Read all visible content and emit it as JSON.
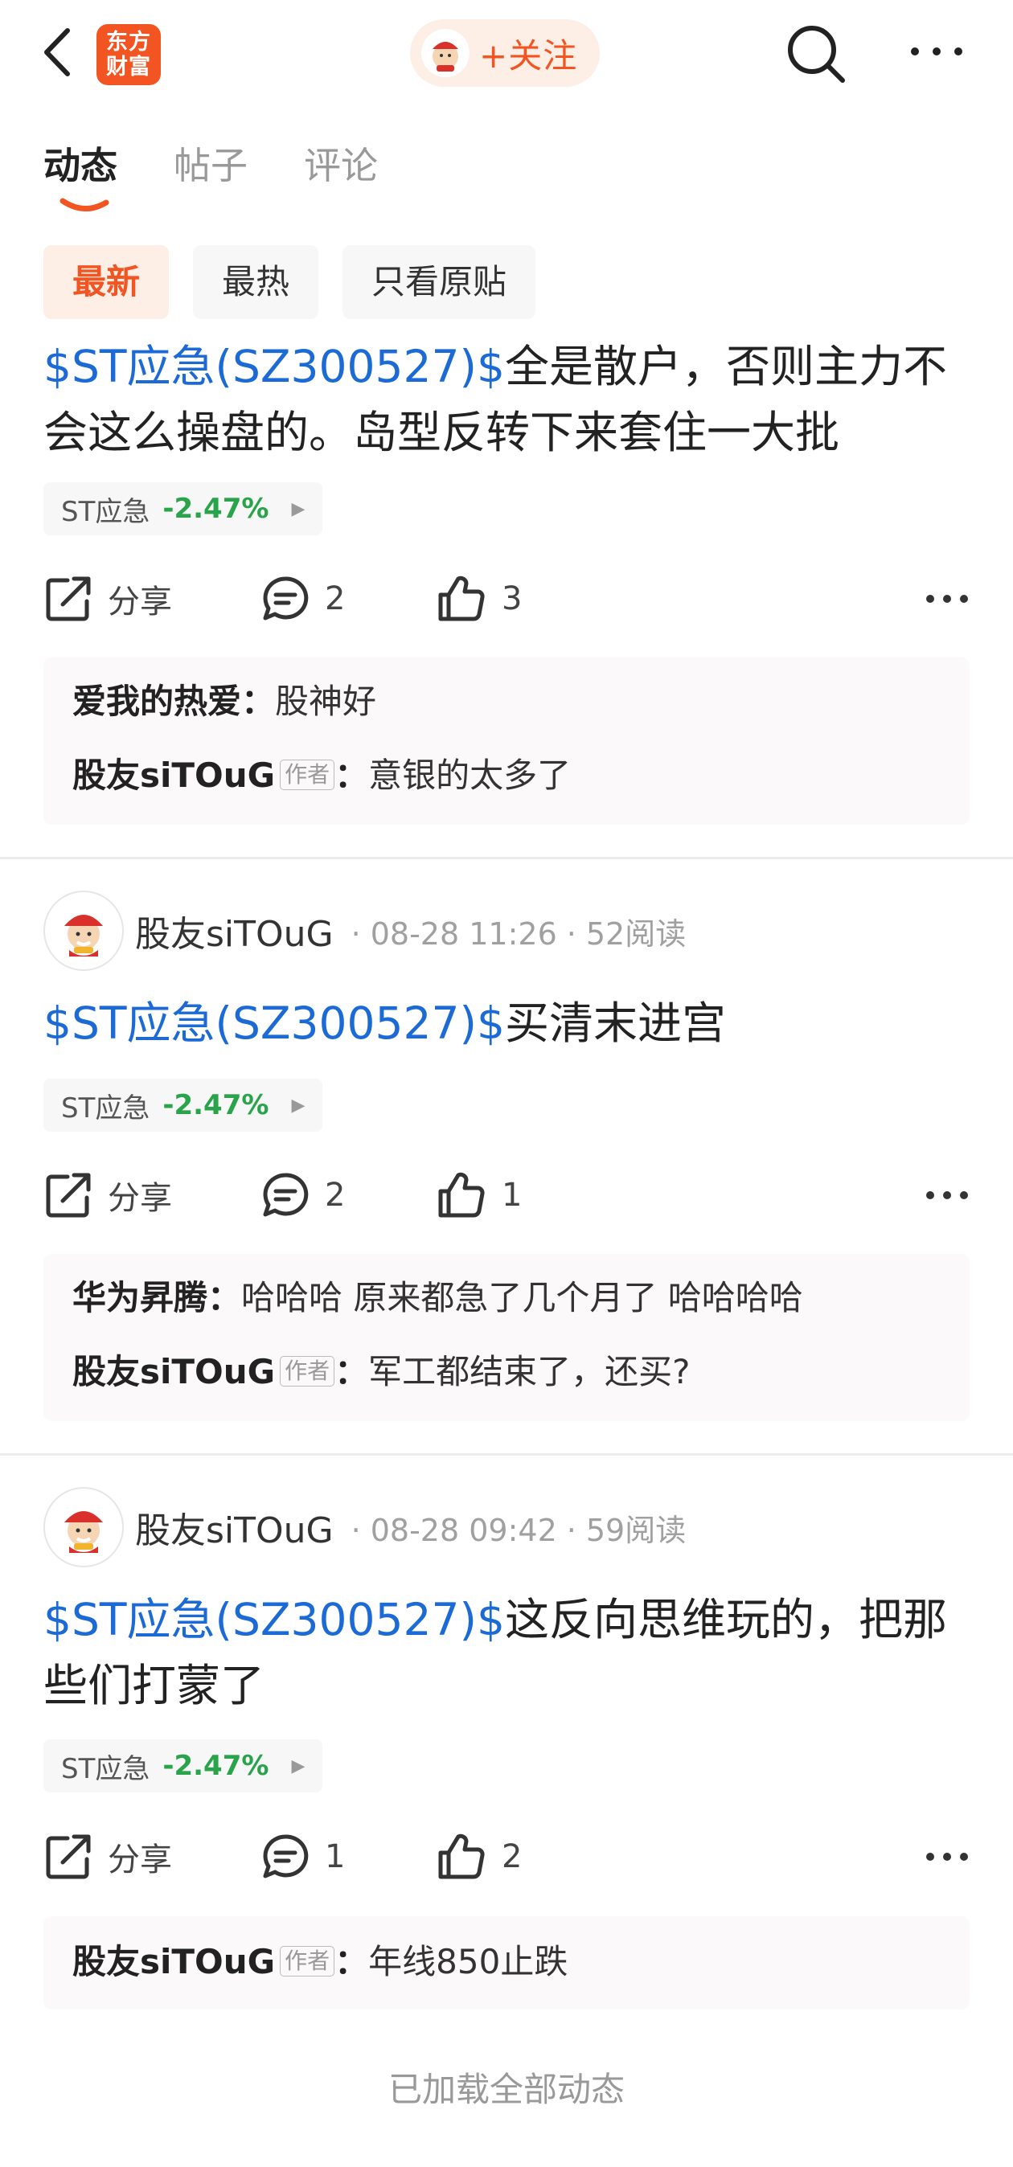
{
  "header": {
    "logo_line1": "东方",
    "logo_line2": "财富",
    "follow_label": "+关注",
    "icons": {
      "back": "back-arrow-icon",
      "search": "search-icon",
      "more": "more-icon"
    }
  },
  "tabs": [
    {
      "label": "动态",
      "active": true
    },
    {
      "label": "帖子",
      "active": false
    },
    {
      "label": "评论",
      "active": false
    }
  ],
  "filters": [
    {
      "label": "最新",
      "active": true
    },
    {
      "label": "最热",
      "active": false
    },
    {
      "label": "只看原贴",
      "active": false
    }
  ],
  "actions": {
    "share_label": "分享"
  },
  "posts": [
    {
      "stock_link": "$ST应急(SZ300527)$",
      "text": "全是散户，否则主力不会这么操盘的。岛型反转下来套住一大批",
      "stock_tag": {
        "name": "ST应急",
        "change": "-2.47%"
      },
      "comment_count": "2",
      "like_count": "3",
      "comments": [
        {
          "user": "爱我的热爱",
          "separator": "：",
          "text": "股神好"
        },
        {
          "user": "股友siTOuG",
          "badge": "作者",
          "separator": "：",
          "text": "意银的太多了"
        }
      ]
    },
    {
      "author": "股友siTOuG",
      "time": "08-28 11:26",
      "reads": "52阅读",
      "stock_link": "$ST应急(SZ300527)$",
      "text": "买清末进宫",
      "stock_tag": {
        "name": "ST应急",
        "change": "-2.47%"
      },
      "comment_count": "2",
      "like_count": "1",
      "comments": [
        {
          "user": "华为昇腾",
          "separator": "：",
          "text": "哈哈哈 原来都急了几个月了 哈哈哈哈"
        },
        {
          "user": "股友siTOuG",
          "badge": "作者",
          "separator": "：",
          "text": "军工都结束了，还买?"
        }
      ]
    },
    {
      "author": "股友siTOuG",
      "time": "08-28 09:42",
      "reads": "59阅读",
      "stock_link": "$ST应急(SZ300527)$",
      "text": "这反向思维玩的，把那些们打蒙了",
      "stock_tag": {
        "name": "ST应急",
        "change": "-2.47%"
      },
      "comment_count": "1",
      "like_count": "2",
      "comments": [
        {
          "user": "股友siTOuG",
          "badge": "作者",
          "separator": "：",
          "text": "年线850止跌"
        }
      ]
    }
  ],
  "footer": {
    "all_loaded": "已加载全部动态"
  },
  "colors": {
    "brand": "#f25522",
    "link": "#1b6ad6",
    "down": "#2aa44a"
  }
}
